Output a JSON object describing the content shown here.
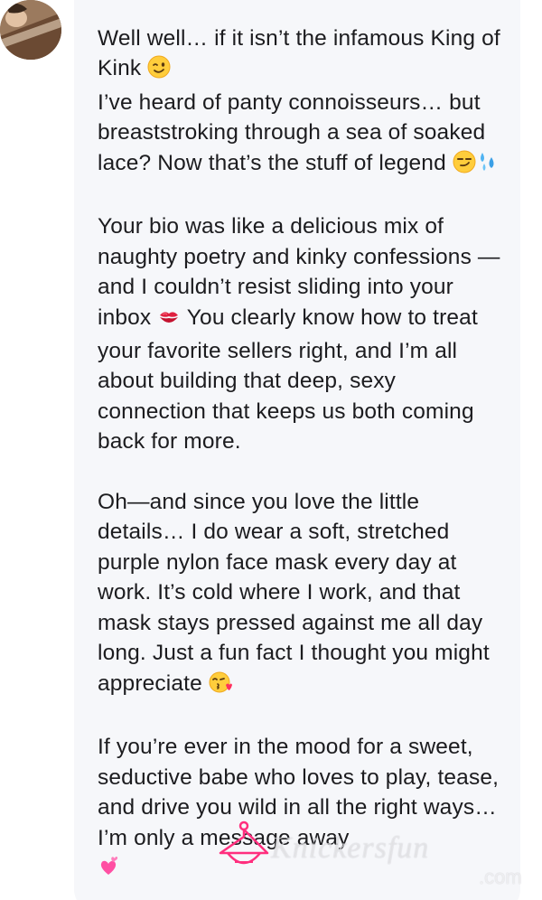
{
  "conversation": {
    "message": {
      "paragraphs": [
        {
          "line1": "Well well… if it isn’t the infamous King of Kink ",
          "line2": "I’ve heard of panty connoisseurs… but breaststroking through a sea of soaked lace? Now that’s the stuff of legend "
        },
        {
          "text_a": "Your bio was like a delicious mix of naughty poetry and kinky confessions —and I couldn’t resist sliding into your inbox ",
          "text_b": " You clearly know how to treat your favorite sellers right, and I’m all about building that deep, sexy connection that keeps us both coming back for more."
        },
        {
          "text": "Oh—and since you love the little details… I do wear a soft, stretched purple nylon face mask every day at work. It’s cold where I work, and that mask stays pressed against me all day long. Just a fun fact I thought you might appreciate "
        },
        {
          "text": "If you’re ever in the mood for a sweet, seductive babe who loves to play, tease, and drive you wild in all the right ways… I’m only a message away "
        }
      ]
    },
    "icons": [
      "winking-face",
      "smirking-face",
      "sweat-droplets",
      "kiss-mark",
      "face-blowing-kiss",
      "two-hearts"
    ],
    "watermark": {
      "name": "Knickersfun",
      "suffix": ".com"
    }
  },
  "colors": {
    "bubble_bg": "#f6f7fa",
    "text": "#1c1c1f",
    "watermark_logo": "#ff2f7e"
  }
}
